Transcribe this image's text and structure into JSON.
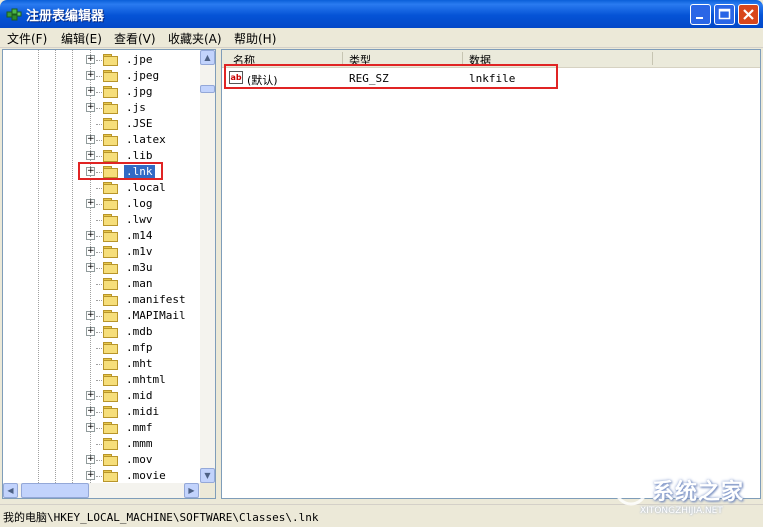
{
  "window": {
    "title": "注册表编辑器"
  },
  "menu": [
    "文件(F)",
    "编辑(E)",
    "查看(V)",
    "收藏夹(A)",
    "帮助(H)"
  ],
  "tree": {
    "items": [
      {
        "label": ".jpe",
        "expandable": true,
        "selected": false
      },
      {
        "label": ".jpeg",
        "expandable": true,
        "selected": false
      },
      {
        "label": ".jpg",
        "expandable": true,
        "selected": false
      },
      {
        "label": ".js",
        "expandable": true,
        "selected": false
      },
      {
        "label": ".JSE",
        "expandable": false,
        "selected": false
      },
      {
        "label": ".latex",
        "expandable": true,
        "selected": false
      },
      {
        "label": ".lib",
        "expandable": true,
        "selected": false
      },
      {
        "label": ".lnk",
        "expandable": true,
        "selected": true
      },
      {
        "label": ".local",
        "expandable": false,
        "selected": false
      },
      {
        "label": ".log",
        "expandable": true,
        "selected": false
      },
      {
        "label": ".lwv",
        "expandable": false,
        "selected": false
      },
      {
        "label": ".m14",
        "expandable": true,
        "selected": false
      },
      {
        "label": ".m1v",
        "expandable": true,
        "selected": false
      },
      {
        "label": ".m3u",
        "expandable": true,
        "selected": false
      },
      {
        "label": ".man",
        "expandable": false,
        "selected": false
      },
      {
        "label": ".manifest",
        "expandable": false,
        "selected": false
      },
      {
        "label": ".MAPIMail",
        "expandable": true,
        "selected": false
      },
      {
        "label": ".mdb",
        "expandable": true,
        "selected": false
      },
      {
        "label": ".mfp",
        "expandable": false,
        "selected": false
      },
      {
        "label": ".mht",
        "expandable": false,
        "selected": false
      },
      {
        "label": ".mhtml",
        "expandable": false,
        "selected": false
      },
      {
        "label": ".mid",
        "expandable": true,
        "selected": false
      },
      {
        "label": ".midi",
        "expandable": true,
        "selected": false
      },
      {
        "label": ".mmf",
        "expandable": true,
        "selected": false
      },
      {
        "label": ".mmm",
        "expandable": false,
        "selected": false
      },
      {
        "label": ".mov",
        "expandable": true,
        "selected": false
      },
      {
        "label": ".movie",
        "expandable": true,
        "selected": false
      }
    ]
  },
  "list": {
    "headers": [
      "名称",
      "类型",
      "数据"
    ],
    "rows": [
      {
        "name": "(默认)",
        "type": "REG_SZ",
        "data": "lnkfile",
        "icon": "string-value-icon"
      }
    ]
  },
  "status": {
    "path": "我的电脑\\HKEY_LOCAL_MACHINE\\SOFTWARE\\Classes\\.lnk"
  },
  "icons": {
    "expand": "+",
    "scroll_up": "▲",
    "scroll_down": "▼",
    "scroll_left": "◀",
    "scroll_right": "▶",
    "value_type": "ab"
  },
  "watermark": {
    "main": "系统之家",
    "sub": "XITONGZHIJIA.NET"
  },
  "colors": {
    "title_bar": "#0553d6",
    "selection": "#316ac5",
    "highlight_box": "#e02424"
  }
}
